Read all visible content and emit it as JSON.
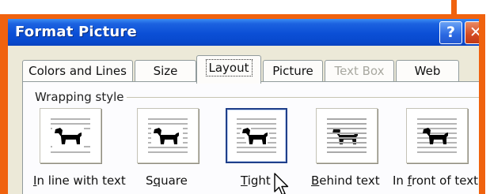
{
  "dialog": {
    "title": "Format Picture",
    "help_button": "?",
    "close_button": "✕"
  },
  "tabs": [
    {
      "label": "Colors and Lines",
      "state": "normal"
    },
    {
      "label": "Size",
      "state": "normal"
    },
    {
      "label": "Layout",
      "state": "active"
    },
    {
      "label": "Picture",
      "state": "normal"
    },
    {
      "label": "Text Box",
      "state": "disabled"
    },
    {
      "label": "Web",
      "state": "normal"
    }
  ],
  "wrapping": {
    "group_label": "Wrapping style",
    "options": [
      {
        "mnemonic": "I",
        "rest": "n line with text",
        "icon": "in-line-with-text-icon"
      },
      {
        "lead": "S",
        "mnemonic": "q",
        "rest": "uare",
        "icon": "square-wrap-icon"
      },
      {
        "mnemonic": "T",
        "rest": "ight",
        "icon": "tight-wrap-icon",
        "selected": true
      },
      {
        "mnemonic": "B",
        "rest": "ehind text",
        "icon": "behind-text-icon"
      },
      {
        "lead": "In ",
        "mnemonic": "f",
        "rest": "ront of text",
        "icon": "in-front-of-text-icon"
      }
    ]
  },
  "colors": {
    "highlight_frame": "#f0620e",
    "titlebar": "#0b4fd6",
    "dialog_face": "#ece9d8",
    "selected_border": "#1f3f8a"
  }
}
